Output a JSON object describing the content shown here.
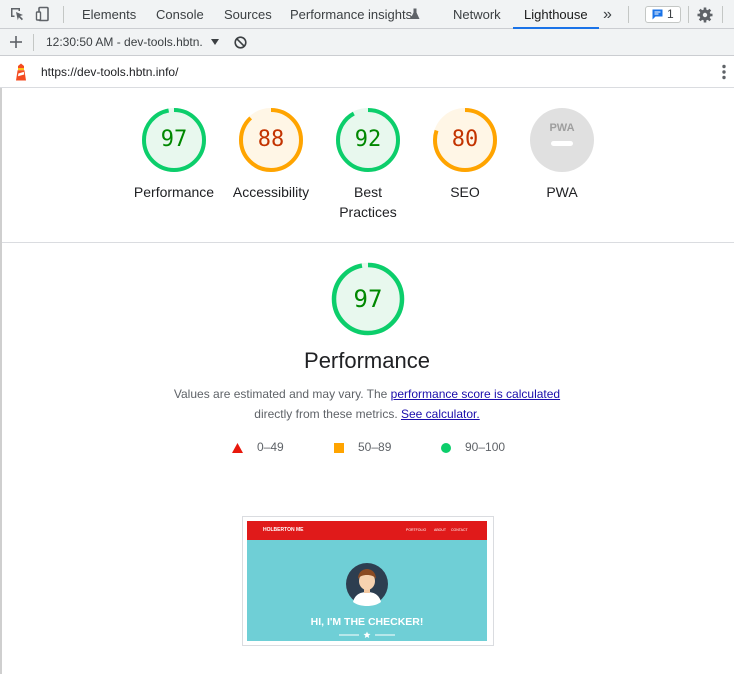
{
  "devtools": {
    "tabs": [
      {
        "label": "Elements"
      },
      {
        "label": "Console"
      },
      {
        "label": "Sources"
      },
      {
        "label": "Performance insights"
      },
      {
        "label": "Network"
      },
      {
        "label": "Lighthouse"
      }
    ],
    "active_tab": "Lighthouse",
    "issues_count": "1",
    "report_selector": "12:30:50 AM - dev-tools.hbtn.",
    "icons": [
      "inspect-icon",
      "device-toolbar-icon",
      "flask-icon",
      "more-tabs-icon",
      "issues-icon",
      "gear-icon",
      "plus-icon",
      "dropdown-caret-icon",
      "clear-icon",
      "lighthouse-logo-icon",
      "kebab-menu-icon"
    ]
  },
  "report": {
    "url": "https://dev-tools.hbtn.info/",
    "categories": [
      {
        "label": "Performance",
        "score": "97",
        "level": 0.97,
        "rating": "pass"
      },
      {
        "label": "Accessibility",
        "score": "88",
        "level": 0.88,
        "rating": "average"
      },
      {
        "label": "Best Practices",
        "score": "92",
        "level": 0.92,
        "rating": "pass"
      },
      {
        "label": "SEO",
        "score": "80",
        "level": 0.8,
        "rating": "average"
      },
      {
        "label": "PWA",
        "score": "",
        "rating": "na"
      }
    ],
    "pwa_badge": "PWA",
    "performance": {
      "score": "97",
      "level": 0.97,
      "title": "Performance",
      "desc_prefix": "Values are estimated and may vary. The ",
      "desc_link1": "performance score is calculated",
      "desc_middle": "directly from these metrics. ",
      "desc_link2": "See calculator."
    },
    "legend": [
      {
        "shape": "triangle",
        "label": "0–49",
        "color": "#e8180c"
      },
      {
        "shape": "square",
        "label": "50–89",
        "color": "#ffa400"
      },
      {
        "shape": "circle",
        "label": "90–100",
        "color": "#0cce6b"
      }
    ],
    "screenshot": {
      "site_name": "HOLBERTON ME",
      "nav": [
        "PORTFOLIO",
        "ABOUT",
        "CONTACT"
      ],
      "headline": "HI, I'M THE CHECKER!"
    }
  },
  "colors": {
    "pass": "#0cce6b",
    "pass_text": "#008800",
    "pass_fill": "#e8f8ee",
    "average": "#ffa400",
    "average_text": "#c33300",
    "average_fill": "#fff6e6",
    "na": "#e0e0e0",
    "accent": "#1a73e8",
    "site_red": "#e01a1a",
    "site_teal": "#6fcfd6"
  }
}
